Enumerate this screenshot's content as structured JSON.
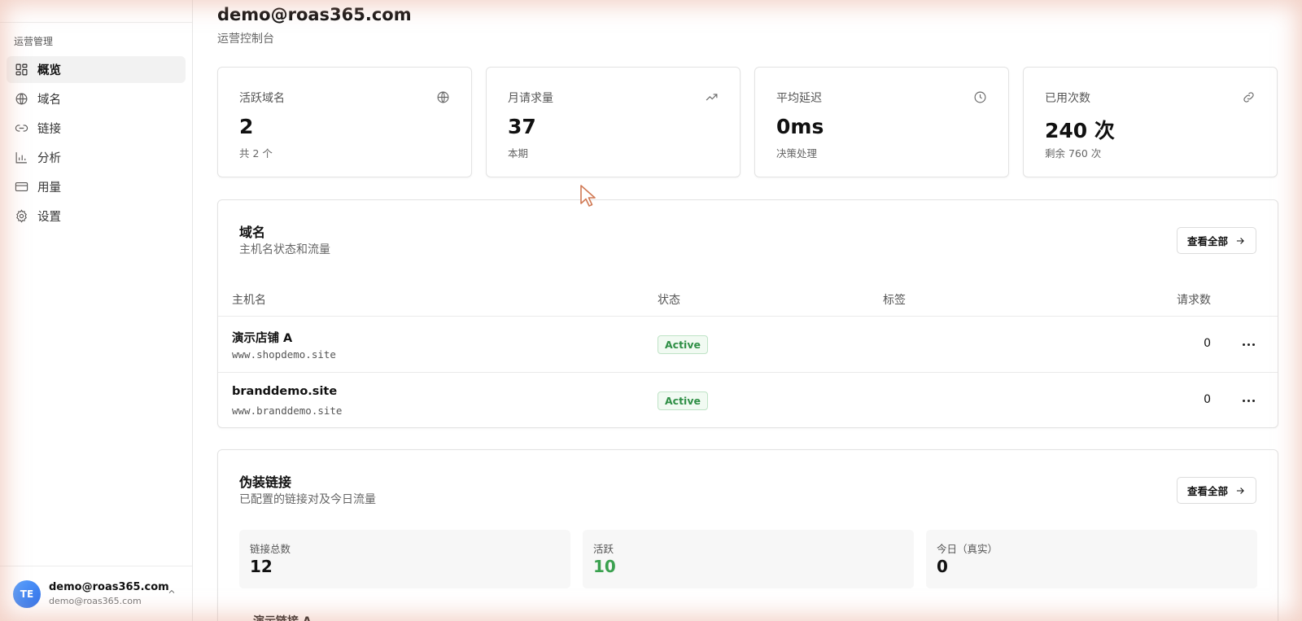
{
  "sidebar": {
    "group_label": "运营管理",
    "items": [
      {
        "label": "概览",
        "icon": "dashboard-icon",
        "active": true
      },
      {
        "label": "域名",
        "icon": "globe-icon"
      },
      {
        "label": "链接",
        "icon": "link-icon"
      },
      {
        "label": "分析",
        "icon": "bar-chart-icon"
      },
      {
        "label": "用量",
        "icon": "credit-card-icon"
      },
      {
        "label": "设置",
        "icon": "gear-icon"
      }
    ],
    "user": {
      "initials": "TE",
      "name": "demo@roas365.com",
      "email": "demo@roas365.com"
    }
  },
  "header": {
    "title": "demo@roas365.com",
    "subtitle": "运营控制台"
  },
  "stats": [
    {
      "label": "活跃域名",
      "value": "2",
      "hint": "共 2 个",
      "icon": "globe-icon"
    },
    {
      "label": "月请求量",
      "value": "37",
      "hint": "本期",
      "icon": "trending-up-icon"
    },
    {
      "label": "平均延迟",
      "value": "0ms",
      "hint": "决策处理",
      "icon": "clock-icon"
    },
    {
      "label": "已用次数",
      "value": "240 次",
      "hint": "剩余 760 次",
      "icon": "link-icon"
    }
  ],
  "domains": {
    "title": "域名",
    "subtitle": "主机名状态和流量",
    "view_all": "查看全部",
    "columns": {
      "host": "主机名",
      "status": "状态",
      "tags": "标签",
      "requests": "请求数"
    },
    "rows": [
      {
        "name": "演示店铺 A",
        "host": "www.shopdemo.site",
        "status": "Active",
        "requests": "0"
      },
      {
        "name": "branddemo.site",
        "host": "www.branddemo.site",
        "status": "Active",
        "requests": "0"
      }
    ]
  },
  "links": {
    "title": "伪装链接",
    "subtitle": "已配置的链接对及今日流量",
    "view_all": "查看全部",
    "stats": [
      {
        "label": "链接总数",
        "value": "12"
      },
      {
        "label": "活跃",
        "value": "10",
        "color": "#3aa14f"
      },
      {
        "label": "今日（真实）",
        "value": "0"
      }
    ],
    "first_item": "演示链接 A"
  },
  "colors": {
    "accent_green": "#3aa14f",
    "badge_green": "#2f8f46",
    "avatar_blue": "#2f6fe8"
  }
}
